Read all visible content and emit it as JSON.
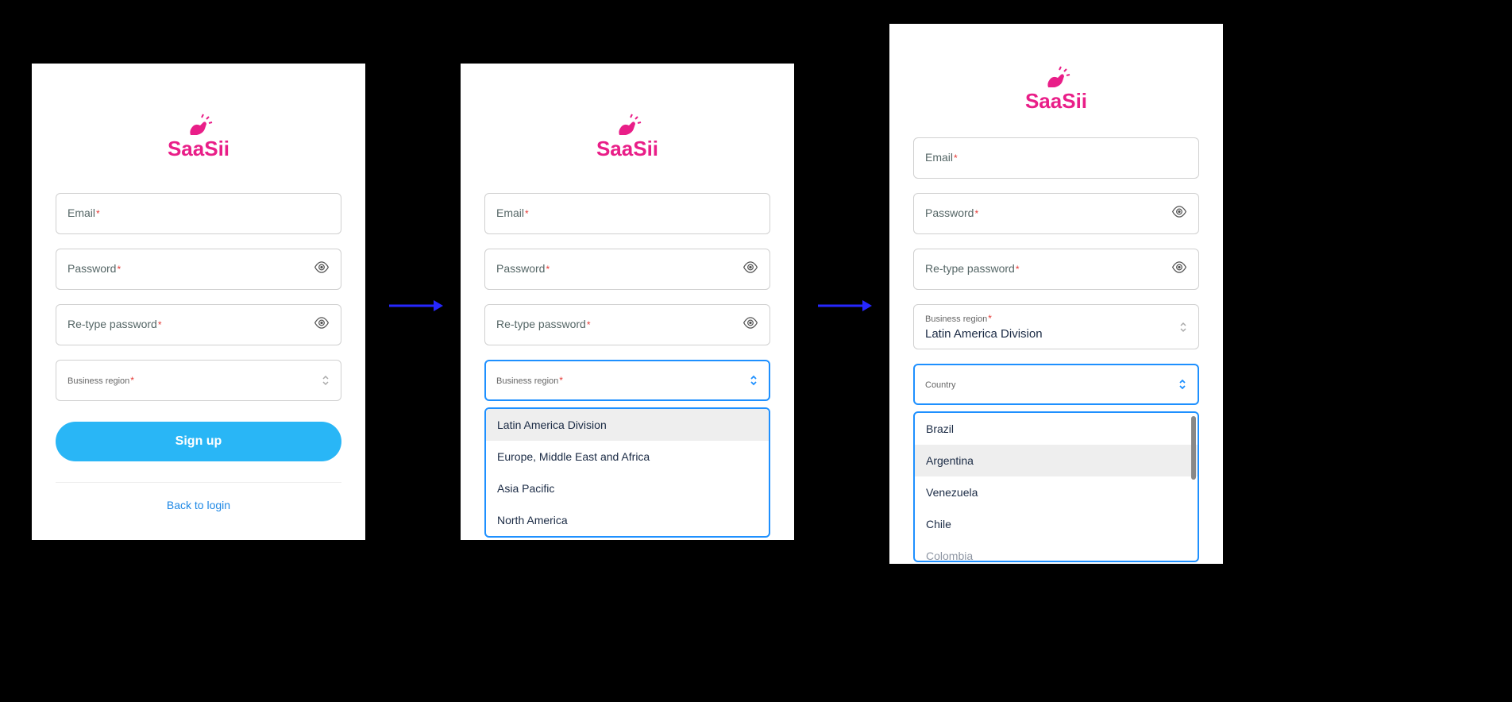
{
  "brand": "SaaSii",
  "labels": {
    "email": "Email",
    "password": "Password",
    "retype": "Re-type password",
    "region": "Business region",
    "country": "Country",
    "signup": "Sign up",
    "back": "Back to login"
  },
  "region_options": [
    "Latin America Division",
    "Europe, Middle East and Africa",
    "Asia Pacific",
    "North America"
  ],
  "selected_region": "Latin America Division",
  "country_options": [
    "Brazil",
    "Argentina",
    "Venezuela",
    "Chile",
    "Colombia"
  ],
  "colors": {
    "brand": "#e91e88",
    "primary": "#29b6f6",
    "focus": "#1e90ff",
    "arrow": "#2627ff"
  }
}
